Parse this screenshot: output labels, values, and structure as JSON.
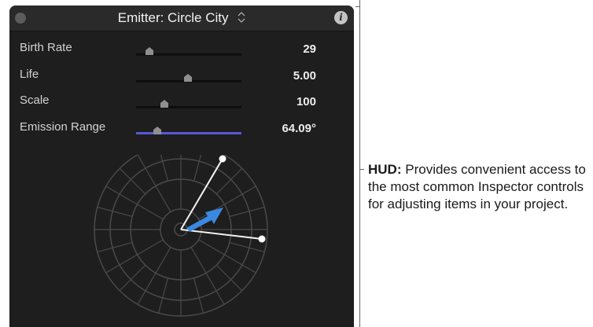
{
  "hud": {
    "title": "Emitter: Circle City",
    "info_label": "i",
    "params": [
      {
        "label": "Birth Rate",
        "value": "29",
        "level": 0.13
      },
      {
        "label": "Life",
        "value": "5.00",
        "level": 0.49
      },
      {
        "label": "Scale",
        "value": "100",
        "level": 0.27
      },
      {
        "label": "Emission Range",
        "value": "64.09°",
        "level": 0.2
      }
    ],
    "emission_angle_deg": 64.09
  },
  "callout": {
    "term": "HUD:",
    "description": "Provides convenient access to the most common Inspector controls for adjusting items in your project."
  },
  "colors": {
    "panel_bg": "#1e1e1e",
    "title_bg": "#2a2a2a",
    "accent_blue": "#5757d8",
    "arrow_blue": "#3b88e0"
  },
  "icons": [
    "close-dot",
    "chevron-updown-icon",
    "info-icon",
    "slider-thumb-icon",
    "direction-arrow-icon"
  ]
}
